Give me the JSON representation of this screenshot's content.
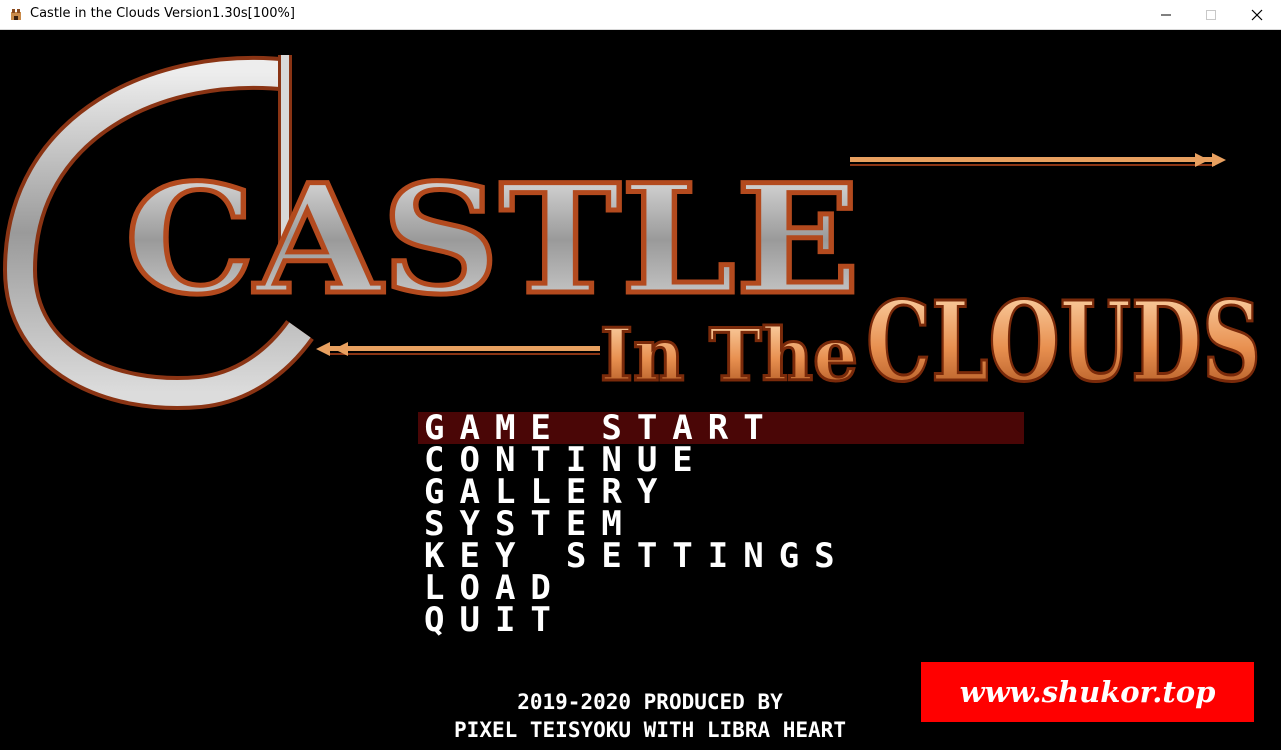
{
  "window": {
    "title": "Castle in the Clouds Version1.30s[100%]",
    "controls": [
      "minimize",
      "maximize",
      "close"
    ]
  },
  "logo": {
    "line1": "CASTLE",
    "line2_small": "In The",
    "line2_large": "CLOUDS"
  },
  "menu": {
    "selected_index": 0,
    "items": [
      {
        "label": "GAME START"
      },
      {
        "label": "CONTINUE"
      },
      {
        "label": "GALLERY"
      },
      {
        "label": "SYSTEM"
      },
      {
        "label": "KEY SETTINGS"
      },
      {
        "label": "LOAD"
      },
      {
        "label": "QUIT"
      }
    ]
  },
  "credits": {
    "line1": "2019-2020 PRODUCED BY",
    "line2": "PIXEL TEISYOKU WITH LIBRA HEART"
  },
  "watermark": {
    "text": "www.shukor.top",
    "color": "#ff0000"
  },
  "colors": {
    "background": "#000000",
    "selection_bar": "#4a0606",
    "logo_silver": "#c9c9c9",
    "logo_orange": "#e8a060",
    "logo_outline": "#b34a1e"
  }
}
